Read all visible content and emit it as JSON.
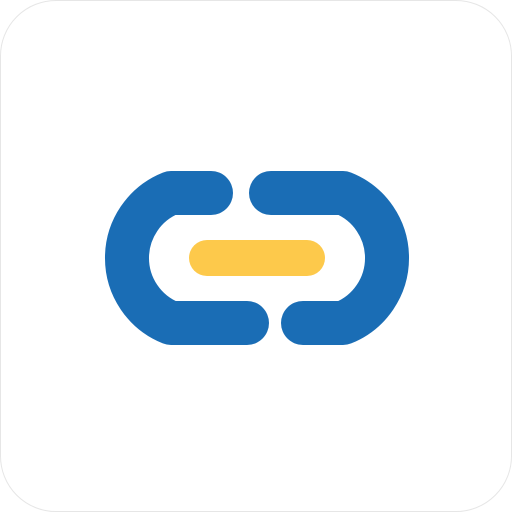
{
  "icon": {
    "name": "link-icon",
    "colors": {
      "background": "#ffffff",
      "border": "#e6e6e6",
      "chain": "#1a6db5",
      "connector": "#fdc94b"
    }
  }
}
